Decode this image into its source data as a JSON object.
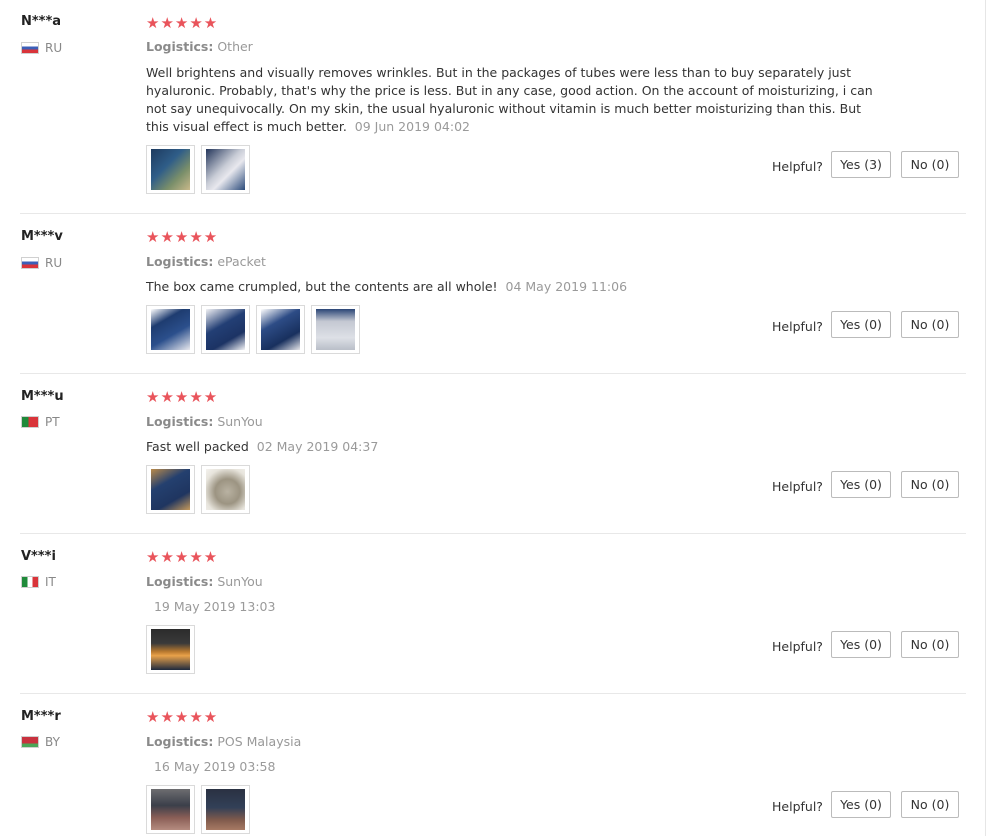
{
  "helpful_label": "Helpful?",
  "logistics_label": "Logistics:",
  "colors": {
    "star": "#e9545b"
  },
  "reviews": [
    {
      "user": "N***a",
      "country": "RU",
      "flag": "russia-flag",
      "stars": "★★★★★",
      "logistics": "Other",
      "content": "Well brightens and visually removes wrinkles. But in the packages of tubes were less than to buy separately just hyaluronic. Probably, that's why the price is less. But in any case, good action. On the account of moisturizing, i can not say unequivocally. On my skin, the usual hyaluronic without vitamin is much better moisturizing than this. But this visual effect is much better.",
      "date": "09 Jun 2019 04:02",
      "photos": [
        "box-photo",
        "ampoule-tray-photo"
      ],
      "yes": "Yes (3)",
      "no": "No (0)"
    },
    {
      "user": "M***v",
      "country": "RU",
      "flag": "russia-flag",
      "stars": "★★★★★",
      "logistics": "ePacket",
      "content": "The box came crumpled, but the contents are all whole!",
      "date": "04 May 2019 11:06",
      "photos": [
        "box-photo",
        "box-photo",
        "box-photo",
        "ampoule-tray-photo"
      ],
      "yes": "Yes (0)",
      "no": "No (0)"
    },
    {
      "user": "M***u",
      "country": "PT",
      "flag": "portugal-flag",
      "stars": "★★★★★",
      "logistics": "SunYou",
      "content": "Fast well packed",
      "date": "02 May 2019 04:37",
      "photos": [
        "box-photo",
        "ampoules-photo"
      ],
      "yes": "Yes (0)",
      "no": "No (0)"
    },
    {
      "user": "V***i",
      "country": "IT",
      "flag": "italy-flag",
      "stars": "★★★★★",
      "logistics": "SunYou",
      "content": "",
      "date": "19 May 2019 13:03",
      "photos": [
        "box-photo"
      ],
      "yes": "Yes (0)",
      "no": "No (0)"
    },
    {
      "user": "M***r",
      "country": "BY",
      "flag": "belarus-flag",
      "stars": "★★★★★",
      "logistics": "POS Malaysia",
      "content": "",
      "date": "16 May 2019 03:58",
      "photos": [
        "box-photo",
        "box-photo"
      ],
      "yes": "Yes (0)",
      "no": "No (0)"
    }
  ]
}
